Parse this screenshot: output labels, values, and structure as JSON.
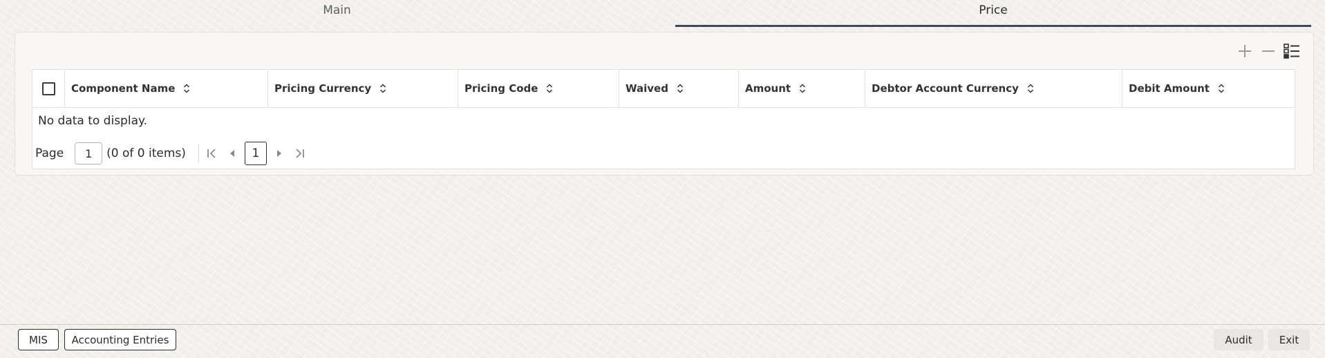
{
  "tabs": [
    {
      "label": "Main",
      "active": false
    },
    {
      "label": "Price",
      "active": true
    }
  ],
  "toolbar": {
    "add_icon": "plus-icon",
    "remove_icon": "minus-icon",
    "columns_icon": "list-settings-icon"
  },
  "table": {
    "columns": [
      "Component Name",
      "Pricing Currency",
      "Pricing Code",
      "Waived",
      "Amount",
      "Debtor Account Currency",
      "Debit Amount"
    ],
    "empty_message": "No data to display."
  },
  "pagination": {
    "page_label": "Page",
    "page_value": "1",
    "items_info": "(0 of 0 items)",
    "current_page": "1"
  },
  "footer": {
    "mis_label": "MIS",
    "accounting_label": "Accounting Entries",
    "audit_label": "Audit",
    "exit_label": "Exit"
  },
  "colors": {
    "active_tab_underline": "#3e4a5a",
    "background": "#f1efeb"
  }
}
